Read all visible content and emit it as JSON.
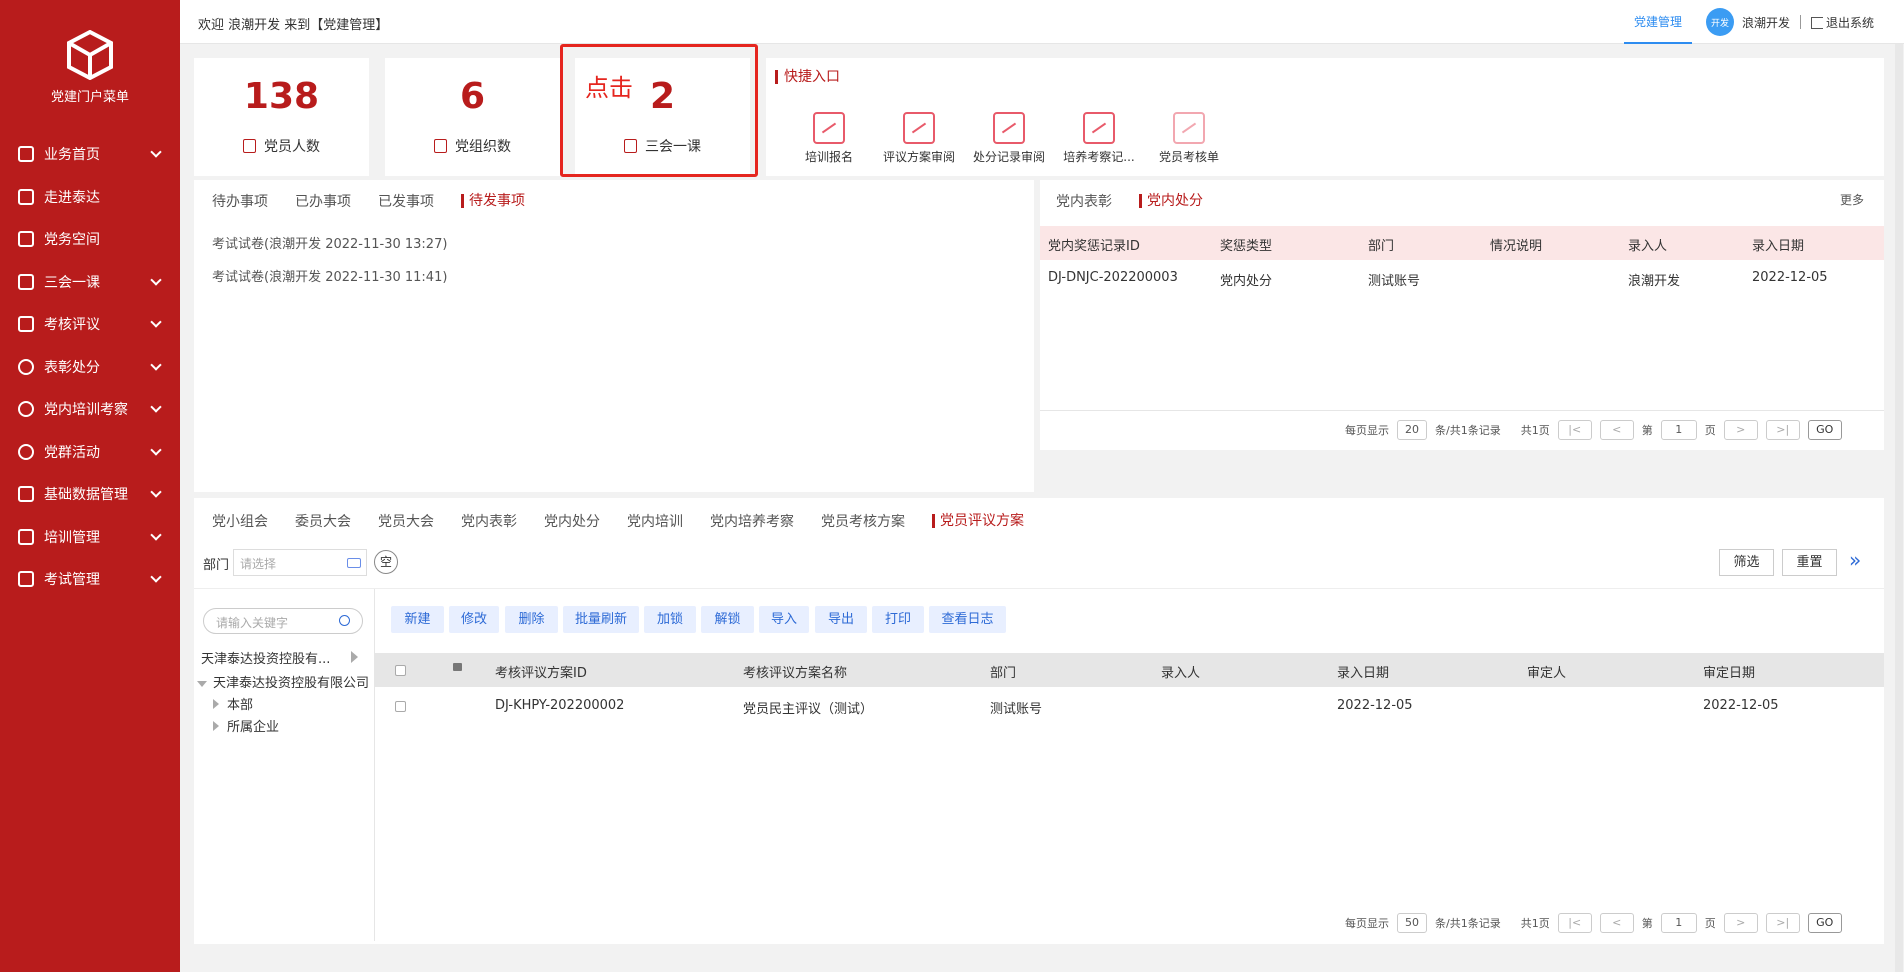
{
  "sidebar": {
    "title": "党建门户菜单",
    "items": [
      {
        "label": "业务首页",
        "icon": "layers-icon",
        "expandable": true
      },
      {
        "label": "走进泰达",
        "icon": "building-icon",
        "expandable": false
      },
      {
        "label": "党务空间",
        "icon": "building-icon",
        "expandable": false
      },
      {
        "label": "三会一课",
        "icon": "book-icon",
        "expandable": true
      },
      {
        "label": "考核评议",
        "icon": "chart-icon",
        "expandable": true
      },
      {
        "label": "表彰处分",
        "icon": "award-icon",
        "expandable": true
      },
      {
        "label": "党内培训考察",
        "icon": "user-icon",
        "expandable": true
      },
      {
        "label": "党群活动",
        "icon": "list-icon",
        "expandable": true
      },
      {
        "label": "基础数据管理",
        "icon": "database-icon",
        "expandable": true
      },
      {
        "label": "培训管理",
        "icon": "chart-icon",
        "expandable": true
      },
      {
        "label": "考试管理",
        "icon": "document-icon",
        "expandable": true
      }
    ]
  },
  "topbar": {
    "welcome": "欢迎 浪潮开发 来到【党建管理】",
    "active_module": "党建管理",
    "avatar_text": "开发",
    "username": "浪潮开发",
    "logout": "退出系统"
  },
  "stats": [
    {
      "value": "138",
      "label": "党员人数"
    },
    {
      "value": "6",
      "label": "党组织数"
    },
    {
      "value": "2",
      "label": "三会一课"
    }
  ],
  "annotation": {
    "click_label": "点击"
  },
  "quick_entry": {
    "title": "快捷入口",
    "items": [
      "培训报名",
      "评议方案审阅",
      "处分记录审阅",
      "培养考察记...",
      "党员考核单"
    ]
  },
  "todo_panel": {
    "tabs": [
      "待办事项",
      "已办事项",
      "已发事项",
      "待发事项"
    ],
    "active_tab": "待发事项",
    "items": [
      "考试试卷(浪潮开发 2022-11-30 13:27)",
      "考试试卷(浪潮开发 2022-11-30 11:41)"
    ]
  },
  "award_panel": {
    "tabs": [
      "党内表彰",
      "党内处分"
    ],
    "active_tab": "党内处分",
    "more": "更多",
    "columns": [
      "党内奖惩记录ID",
      "奖惩类型",
      "部门",
      "情况说明",
      "录入人",
      "录入日期"
    ],
    "rows": [
      [
        "DJ-DNJC-202200003",
        "党内处分",
        "测试账号",
        "",
        "浪潮开发",
        "2022-12-05"
      ]
    ],
    "pager": {
      "per_page_label": "每页显示",
      "per_page": "20",
      "summary": "条/共1条记录",
      "pages": "共1页",
      "page_prefix": "第",
      "page": "1",
      "page_suffix": "页",
      "go": "GO"
    }
  },
  "bottom_panel": {
    "tabs": [
      "党小组会",
      "委员大会",
      "党员大会",
      "党内表彰",
      "党内处分",
      "党内培训",
      "党内培养考察",
      "党员考核方案",
      "党员评议方案"
    ],
    "active_tab": "党员评议方案",
    "filter_label": "部门",
    "filter_placeholder": "请选择",
    "clear_label": "空",
    "filter_button": "筛选",
    "reset_button": "重置",
    "tree_search_placeholder": "请输入关键字",
    "tree_dropdown": "天津泰达投资控股有...",
    "tree_root": "天津泰达投资控股有限公司",
    "tree_children": [
      "本部",
      "所属企业"
    ],
    "toolbar": [
      "新建",
      "修改",
      "删除",
      "批量刷新",
      "加锁",
      "解锁",
      "导入",
      "导出",
      "打印",
      "查看日志"
    ],
    "columns": [
      "考核评议方案ID",
      "考核评议方案名称",
      "部门",
      "录入人",
      "录入日期",
      "审定人",
      "审定日期"
    ],
    "rows": [
      [
        "DJ-KHPY-202200002",
        "党员民主评议（测试）",
        "测试账号",
        "",
        "2022-12-05",
        "",
        "2022-12-05"
      ]
    ],
    "pager": {
      "per_page_label": "每页显示",
      "per_page": "50",
      "summary": "条/共1条记录",
      "pages": "共1页",
      "page_prefix": "第",
      "page": "1",
      "page_suffix": "页",
      "go": "GO"
    }
  },
  "colors": {
    "brand": "#b81c1c",
    "highlight": "#e5261f",
    "accent": "#2d8cf0"
  }
}
